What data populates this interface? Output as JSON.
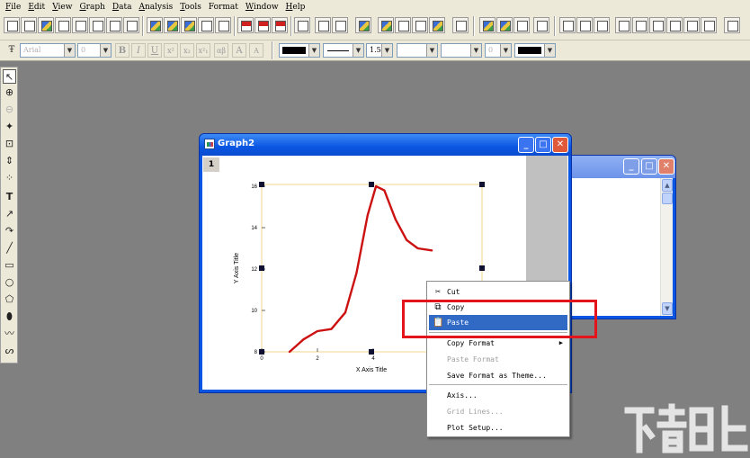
{
  "menu": [
    {
      "accel": "F",
      "rest": "ile"
    },
    {
      "accel": "E",
      "rest": "dit"
    },
    {
      "accel": "V",
      "rest": "iew"
    },
    {
      "accel": "G",
      "rest": "raph"
    },
    {
      "accel": "D",
      "rest": "ata"
    },
    {
      "accel": "A",
      "rest": "nalysis"
    },
    {
      "accel": "T",
      "rest": "ools"
    },
    {
      "accel": "",
      "rest": "Format"
    },
    {
      "accel": "W",
      "rest": "indow"
    },
    {
      "accel": "H",
      "rest": "elp"
    }
  ],
  "format_toolbar": {
    "font_name": "Arial",
    "font_size": "0",
    "line_width": "1.5",
    "symbol_size": "0"
  },
  "graph_window": {
    "title": "Graph2",
    "page_tab": "1"
  },
  "chart_data": {
    "type": "line",
    "xlabel": "X Axis Title",
    "ylabel": "Y Axis Title",
    "x_ticks": [
      "0",
      "2",
      "4"
    ],
    "y_ticks": [
      "8",
      "10",
      "12",
      "14",
      "16"
    ],
    "xlim": [
      0,
      8
    ],
    "ylim": [
      8,
      17
    ],
    "series": [
      {
        "x": [
          1.0,
          1.5,
          2.0,
          2.5,
          3.0,
          3.4,
          3.8,
          4.1,
          4.4,
          4.8,
          5.2,
          5.6,
          6.1
        ],
        "y": [
          8.0,
          8.6,
          9.0,
          9.1,
          9.9,
          11.8,
          14.6,
          16.0,
          15.8,
          14.4,
          13.4,
          13.0,
          12.9
        ]
      }
    ],
    "colors": {
      "line": "#cc1111",
      "frame": "#f0d58a"
    }
  },
  "context_menu": {
    "items": [
      {
        "label": "Cut",
        "icon": "scissors-icon",
        "enabled": true
      },
      {
        "label": "Copy",
        "icon": "copy-icon",
        "enabled": true
      },
      {
        "label": "Paste",
        "icon": "paste-icon",
        "enabled": true,
        "highlighted": true
      },
      {
        "label": "Copy Format",
        "enabled": true,
        "submenu": true
      },
      {
        "label": "Paste Format",
        "enabled": false
      },
      {
        "label": "Save Format as Theme...",
        "enabled": true
      },
      {
        "label": "Axis...",
        "enabled": true
      },
      {
        "label": "Grid Lines...",
        "enabled": false
      },
      {
        "label": "Plot Setup...",
        "enabled": true
      }
    ],
    "highlight_color": "#316ac5",
    "annotation_color": "#e3141c"
  }
}
